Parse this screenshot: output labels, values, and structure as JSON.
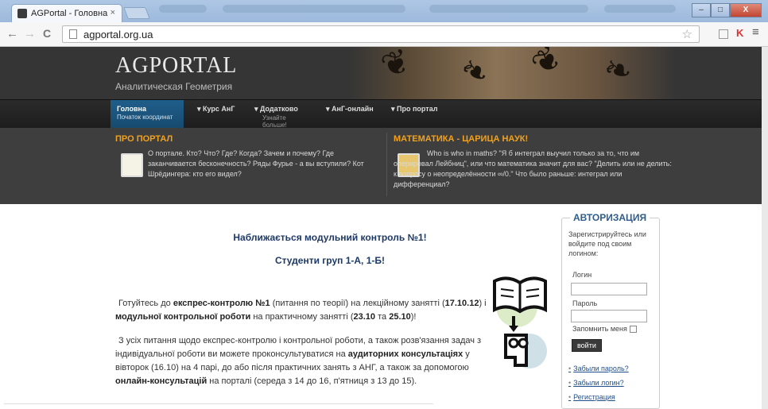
{
  "browser": {
    "tab_title": "AGPortal - Головна",
    "tab_close": "×",
    "url": "agportal.org.ua",
    "back_icon": "←",
    "forward_icon": "→",
    "reload_icon": "C",
    "star_icon": "☆",
    "menu_icon": "≡",
    "win_min": "–",
    "win_max": "□",
    "win_close": "X"
  },
  "header": {
    "logo_title": "AGPORTAL",
    "logo_subtitle": "Аналитическая Геометрия"
  },
  "menu": {
    "items": [
      {
        "label": "Головна",
        "sub": "Початок координат"
      },
      {
        "label": "▾ Курс АнГ",
        "sub": ""
      },
      {
        "label": "▾ Додатково",
        "sub": "Узнайте больше!"
      },
      {
        "label": "▾ АнГ-онлайн",
        "sub": ""
      },
      {
        "label": "▾ Про портал",
        "sub": ""
      }
    ]
  },
  "promo": {
    "left_title": "ПРО ПОРТАЛ",
    "left_text": "О портале. Кто? Что? Где? Когда? Зачем и почему? Где заканчивается бесконечность? Ряды Фурье - а вы вступили? Кот Шрёдингера: кто его видел?",
    "right_title": "МАТЕМАТИКА - ЦАРИЦА НАУК!",
    "right_text": "Who is who in maths? \"Я б интеграл выучил только за то, что им оперировал Лейбниц\", или что математика значит для вас? \"Делить или не делить: к вопросу о неопределённости ∞/0.\" Что было раньше: интеграл или дифференциал?"
  },
  "content": {
    "heading1": "Наближається модульний контроль №1!",
    "heading2": "Студенти груп 1-А, 1-Б!",
    "p1_a": "Готуйтесь до ",
    "p1_b": "експрес-контролю №1",
    "p1_c": " (питання по теорії) на лекційному занятті (",
    "p1_d": "17.10.12",
    "p1_e": ") і ",
    "p1_f": "модульної контрольної роботи",
    "p1_g": " на практичному занятті (",
    "p1_h": "23.10",
    "p1_i": " та ",
    "p1_j": "25.10",
    "p1_k": ")!",
    "p2_a": "З усіх питання щодо експрес-контролю і контрольної роботи, а також розв'язання задач з індивідуальної роботи ви можете проконсультуватися на ",
    "p2_b": "аудиторних консультаціях",
    "p2_c": " у вівторок (16.10) на 4 парі, до або після практичних занять з АНГ, а також за допомогою ",
    "p2_d": "онлайн-консультацій",
    "p2_e": " на порталі (середа з 14 до 16, п'ятниця з 13 до 15)."
  },
  "auth": {
    "title": "АВТОРИЗАЦИЯ",
    "desc": "Зарегистрируйтесь или войдите под своим логином:",
    "login_label": "Логин",
    "password_label": "Пароль",
    "remember_label": "Запомнить меня",
    "login_button": "войти",
    "links": [
      "Забыли пароль?",
      "Забыли логин?",
      "Регистрация"
    ]
  }
}
